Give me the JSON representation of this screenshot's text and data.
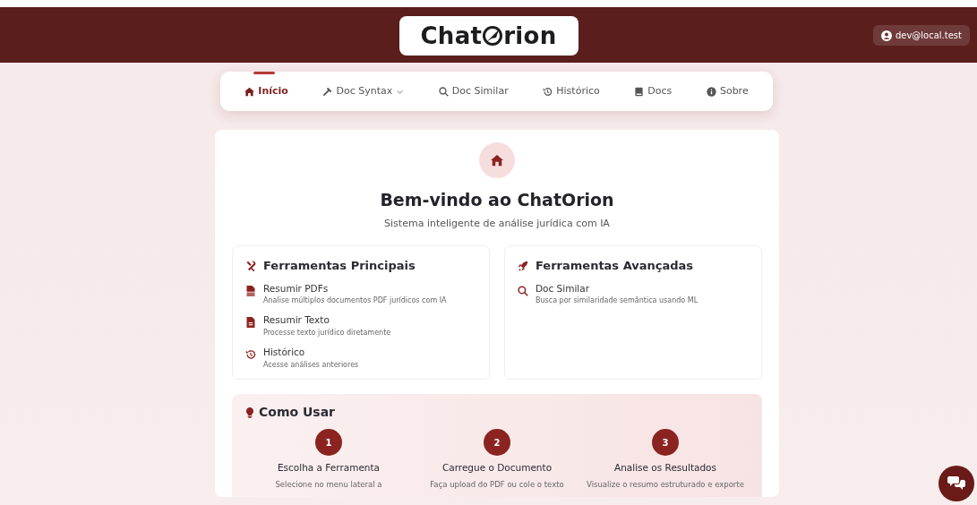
{
  "header": {
    "logo": {
      "before": "Chat",
      "after": "rion"
    },
    "user": "dev@local.test"
  },
  "nav": [
    {
      "label": "Início",
      "selected": true,
      "dropdown": false
    },
    {
      "label": "Doc Syntax",
      "selected": false,
      "dropdown": true
    },
    {
      "label": "Doc Similar",
      "selected": false,
      "dropdown": false
    },
    {
      "label": "Histórico",
      "selected": false,
      "dropdown": false
    },
    {
      "label": "Docs",
      "selected": false,
      "dropdown": false
    },
    {
      "label": "Sobre",
      "selected": false,
      "dropdown": false
    }
  ],
  "welcome": {
    "title": "Bem-vindo ao ChatOrion",
    "subtitle": "Sistema inteligente de análise jurídica com IA"
  },
  "tool_cards": [
    {
      "title": "Ferramentas Principais",
      "items": [
        {
          "title": "Resumir PDFs",
          "description": "Analise múltiplos documentos PDF jurídicos com IA"
        },
        {
          "title": "Resumir Texto",
          "description": "Processe texto jurídico diretamente"
        },
        {
          "title": "Histórico",
          "description": "Acesse análises anteriores"
        }
      ]
    },
    {
      "title": "Ferramentas Avançadas",
      "items": [
        {
          "title": "Doc Similar",
          "description": "Busca por similaridade semântica usando ML"
        }
      ]
    }
  ],
  "how_to": {
    "title": "Como Usar",
    "steps": [
      {
        "number": "1",
        "title": "Escolha a Ferramenta",
        "description": "Selecione no menu lateral a"
      },
      {
        "number": "2",
        "title": "Carregue o Documento",
        "description": "Faça upload do PDF ou cole o texto"
      },
      {
        "number": "3",
        "title": "Analise os Resultados",
        "description": "Visualize o resumo estruturado e exporte"
      }
    ]
  }
}
